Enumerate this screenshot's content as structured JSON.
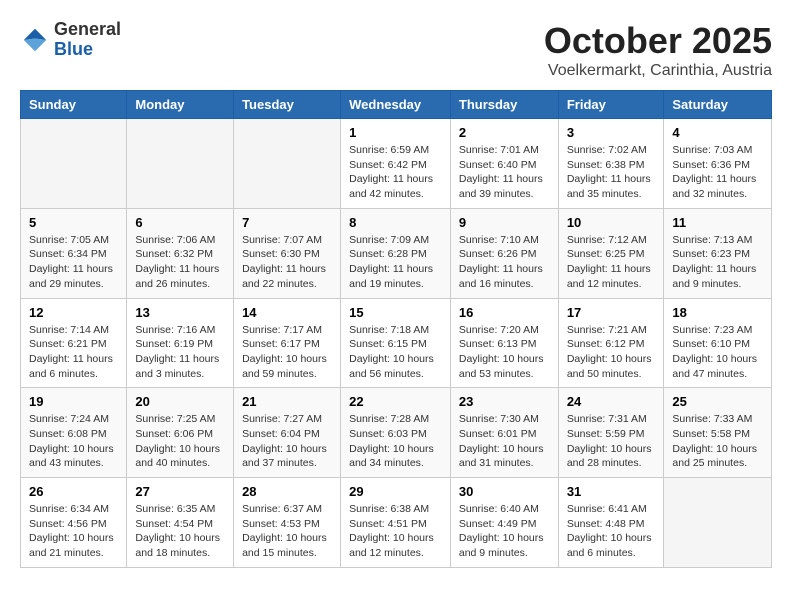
{
  "header": {
    "logo_general": "General",
    "logo_blue": "Blue",
    "title": "October 2025",
    "location": "Voelkermarkt, Carinthia, Austria"
  },
  "weekdays": [
    "Sunday",
    "Monday",
    "Tuesday",
    "Wednesday",
    "Thursday",
    "Friday",
    "Saturday"
  ],
  "weeks": [
    [
      {
        "day": "",
        "info": ""
      },
      {
        "day": "",
        "info": ""
      },
      {
        "day": "",
        "info": ""
      },
      {
        "day": "1",
        "info": "Sunrise: 6:59 AM\nSunset: 6:42 PM\nDaylight: 11 hours and 42 minutes."
      },
      {
        "day": "2",
        "info": "Sunrise: 7:01 AM\nSunset: 6:40 PM\nDaylight: 11 hours and 39 minutes."
      },
      {
        "day": "3",
        "info": "Sunrise: 7:02 AM\nSunset: 6:38 PM\nDaylight: 11 hours and 35 minutes."
      },
      {
        "day": "4",
        "info": "Sunrise: 7:03 AM\nSunset: 6:36 PM\nDaylight: 11 hours and 32 minutes."
      }
    ],
    [
      {
        "day": "5",
        "info": "Sunrise: 7:05 AM\nSunset: 6:34 PM\nDaylight: 11 hours and 29 minutes."
      },
      {
        "day": "6",
        "info": "Sunrise: 7:06 AM\nSunset: 6:32 PM\nDaylight: 11 hours and 26 minutes."
      },
      {
        "day": "7",
        "info": "Sunrise: 7:07 AM\nSunset: 6:30 PM\nDaylight: 11 hours and 22 minutes."
      },
      {
        "day": "8",
        "info": "Sunrise: 7:09 AM\nSunset: 6:28 PM\nDaylight: 11 hours and 19 minutes."
      },
      {
        "day": "9",
        "info": "Sunrise: 7:10 AM\nSunset: 6:26 PM\nDaylight: 11 hours and 16 minutes."
      },
      {
        "day": "10",
        "info": "Sunrise: 7:12 AM\nSunset: 6:25 PM\nDaylight: 11 hours and 12 minutes."
      },
      {
        "day": "11",
        "info": "Sunrise: 7:13 AM\nSunset: 6:23 PM\nDaylight: 11 hours and 9 minutes."
      }
    ],
    [
      {
        "day": "12",
        "info": "Sunrise: 7:14 AM\nSunset: 6:21 PM\nDaylight: 11 hours and 6 minutes."
      },
      {
        "day": "13",
        "info": "Sunrise: 7:16 AM\nSunset: 6:19 PM\nDaylight: 11 hours and 3 minutes."
      },
      {
        "day": "14",
        "info": "Sunrise: 7:17 AM\nSunset: 6:17 PM\nDaylight: 10 hours and 59 minutes."
      },
      {
        "day": "15",
        "info": "Sunrise: 7:18 AM\nSunset: 6:15 PM\nDaylight: 10 hours and 56 minutes."
      },
      {
        "day": "16",
        "info": "Sunrise: 7:20 AM\nSunset: 6:13 PM\nDaylight: 10 hours and 53 minutes."
      },
      {
        "day": "17",
        "info": "Sunrise: 7:21 AM\nSunset: 6:12 PM\nDaylight: 10 hours and 50 minutes."
      },
      {
        "day": "18",
        "info": "Sunrise: 7:23 AM\nSunset: 6:10 PM\nDaylight: 10 hours and 47 minutes."
      }
    ],
    [
      {
        "day": "19",
        "info": "Sunrise: 7:24 AM\nSunset: 6:08 PM\nDaylight: 10 hours and 43 minutes."
      },
      {
        "day": "20",
        "info": "Sunrise: 7:25 AM\nSunset: 6:06 PM\nDaylight: 10 hours and 40 minutes."
      },
      {
        "day": "21",
        "info": "Sunrise: 7:27 AM\nSunset: 6:04 PM\nDaylight: 10 hours and 37 minutes."
      },
      {
        "day": "22",
        "info": "Sunrise: 7:28 AM\nSunset: 6:03 PM\nDaylight: 10 hours and 34 minutes."
      },
      {
        "day": "23",
        "info": "Sunrise: 7:30 AM\nSunset: 6:01 PM\nDaylight: 10 hours and 31 minutes."
      },
      {
        "day": "24",
        "info": "Sunrise: 7:31 AM\nSunset: 5:59 PM\nDaylight: 10 hours and 28 minutes."
      },
      {
        "day": "25",
        "info": "Sunrise: 7:33 AM\nSunset: 5:58 PM\nDaylight: 10 hours and 25 minutes."
      }
    ],
    [
      {
        "day": "26",
        "info": "Sunrise: 6:34 AM\nSunset: 4:56 PM\nDaylight: 10 hours and 21 minutes."
      },
      {
        "day": "27",
        "info": "Sunrise: 6:35 AM\nSunset: 4:54 PM\nDaylight: 10 hours and 18 minutes."
      },
      {
        "day": "28",
        "info": "Sunrise: 6:37 AM\nSunset: 4:53 PM\nDaylight: 10 hours and 15 minutes."
      },
      {
        "day": "29",
        "info": "Sunrise: 6:38 AM\nSunset: 4:51 PM\nDaylight: 10 hours and 12 minutes."
      },
      {
        "day": "30",
        "info": "Sunrise: 6:40 AM\nSunset: 4:49 PM\nDaylight: 10 hours and 9 minutes."
      },
      {
        "day": "31",
        "info": "Sunrise: 6:41 AM\nSunset: 4:48 PM\nDaylight: 10 hours and 6 minutes."
      },
      {
        "day": "",
        "info": ""
      }
    ]
  ]
}
